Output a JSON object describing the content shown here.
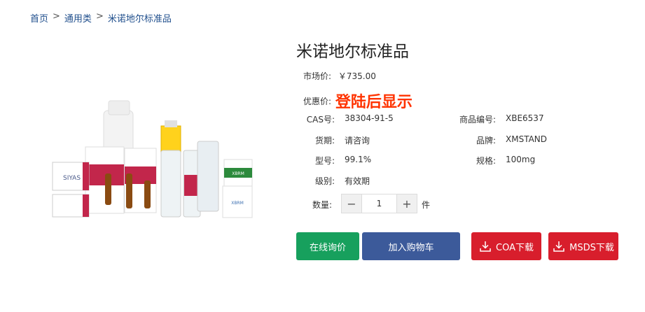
{
  "breadcrumb": {
    "home": "首页",
    "category": "通用类",
    "current": "米诺地尔标准品",
    "separator": ">"
  },
  "product": {
    "title": "米诺地尔标准品",
    "market_price_label": "市场价:",
    "market_price": "￥735.00",
    "promo_label": "优惠价:",
    "promo_value": "登陆后显示",
    "specs_left": [
      {
        "label": "CAS号:",
        "value": "38304-91-5"
      },
      {
        "label": "货期:",
        "value": "请咨询"
      },
      {
        "label": "型号:",
        "value": "99.1%"
      },
      {
        "label": "级别:",
        "value": "有效期"
      }
    ],
    "specs_right": [
      {
        "label": "商品编号:",
        "value": "XBE6537"
      },
      {
        "label": "品牌:",
        "value": "XMSTAND"
      },
      {
        "label": "规格:",
        "value": "100mg"
      }
    ],
    "quantity_label": "数量:",
    "quantity": "1",
    "unit": "件",
    "image_label_1": "XBRM",
    "image_label_2": "XBRM",
    "image_label_3": "SIYAS"
  },
  "buttons": {
    "inquiry": "在线询价",
    "cart": "加入购物车",
    "coa": "COA下载",
    "msds": "MSDS下载"
  },
  "colors": {
    "green": "#17a05d",
    "blue": "#3c5a9a",
    "red": "#d81e2c",
    "promo": "#ff3300"
  }
}
